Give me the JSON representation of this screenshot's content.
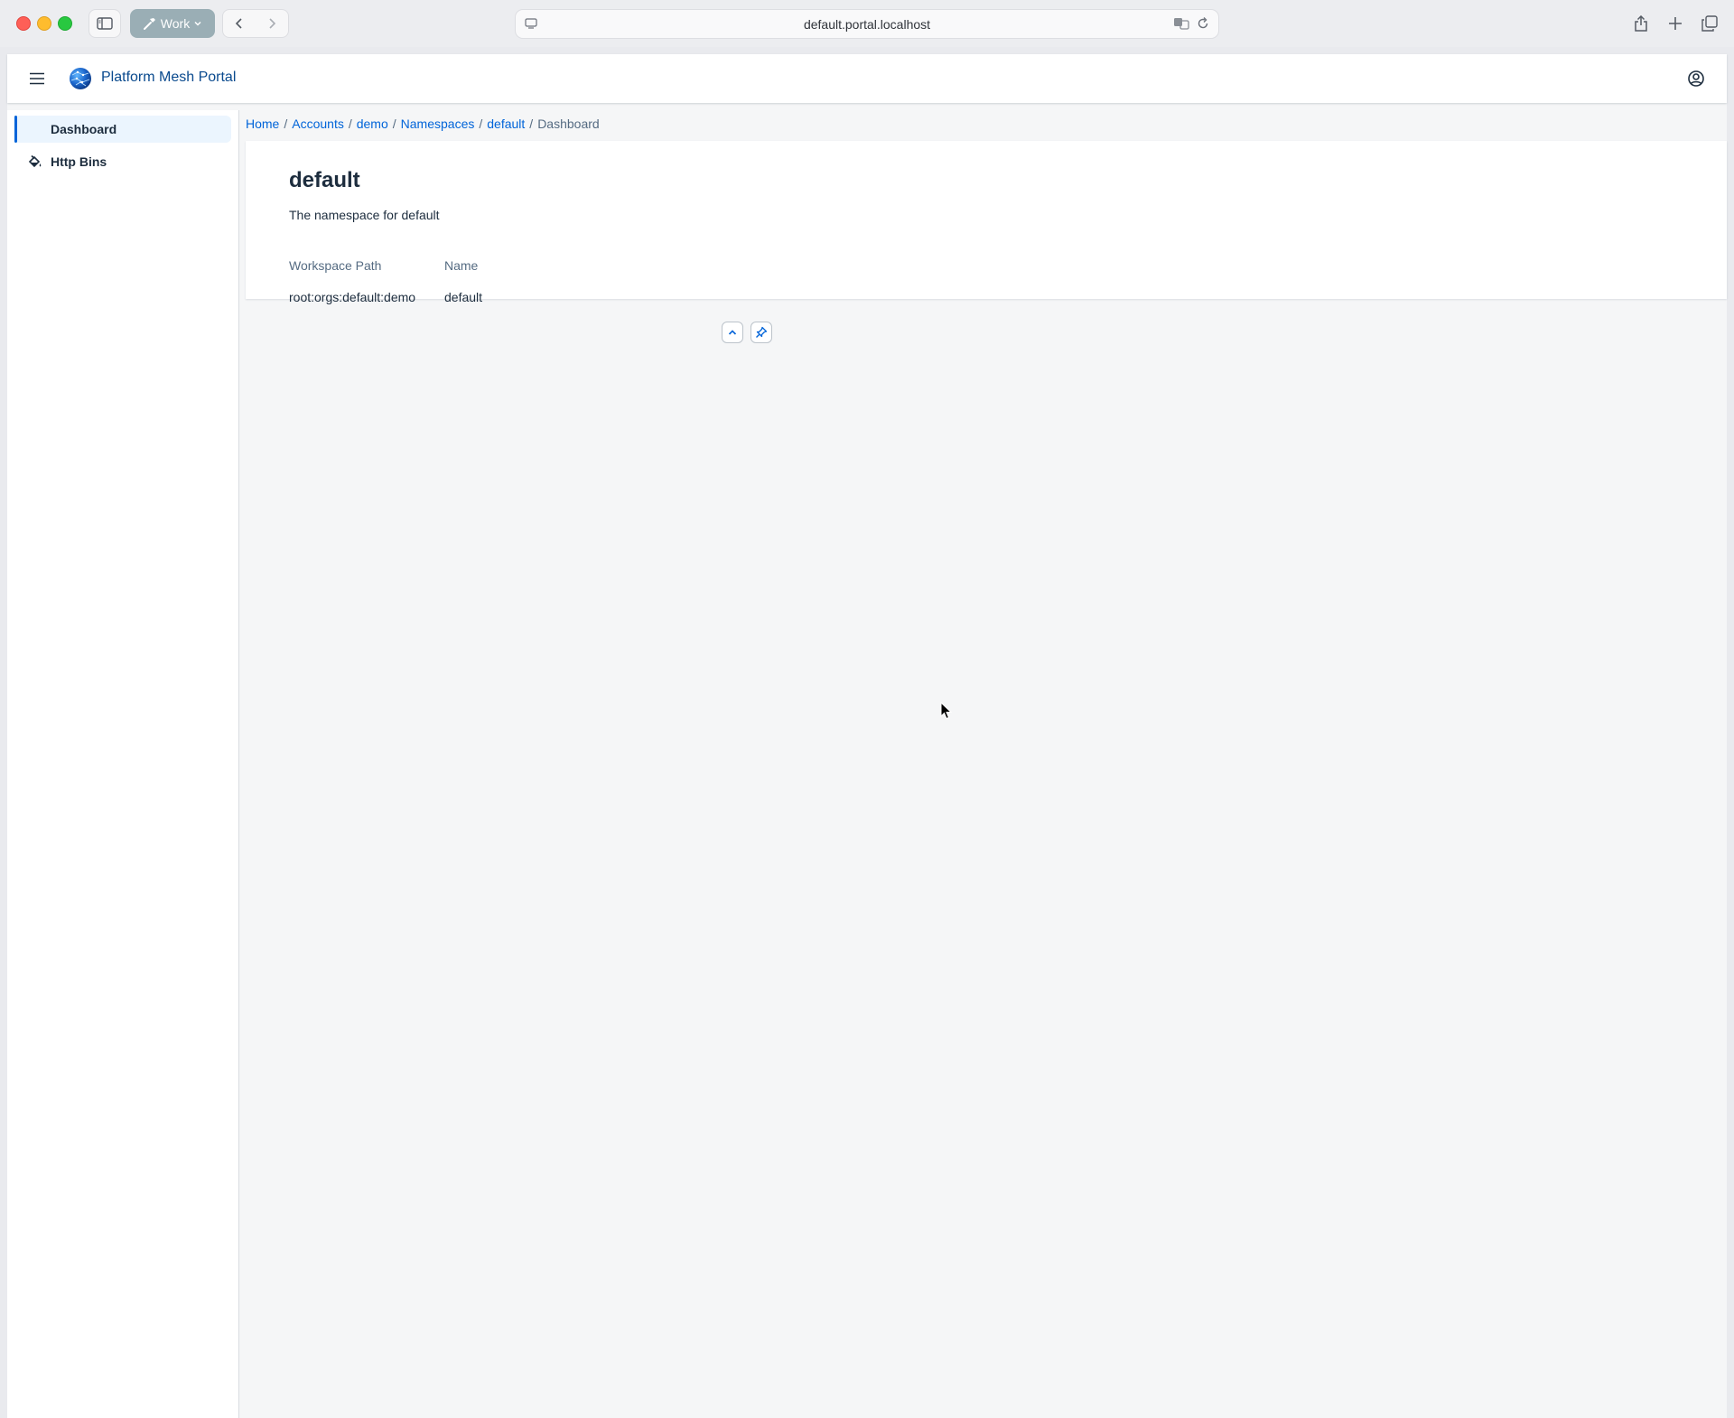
{
  "browser": {
    "profile_label": "Work",
    "url": "default.portal.localhost"
  },
  "shellbar": {
    "title": "Platform Mesh Portal"
  },
  "sidebar": {
    "items": [
      {
        "label": "Dashboard",
        "active": true
      },
      {
        "label": "Http Bins",
        "icon": "paint-bucket-icon"
      }
    ]
  },
  "breadcrumb": {
    "items": [
      {
        "label": "Home",
        "link": true
      },
      {
        "label": "Accounts",
        "link": true
      },
      {
        "label": "demo",
        "link": true
      },
      {
        "label": "Namespaces",
        "link": true
      },
      {
        "label": "default",
        "link": true
      },
      {
        "label": "Dashboard",
        "link": false
      }
    ],
    "separator": "/"
  },
  "header": {
    "title": "default",
    "subtitle": "The namespace for default",
    "attributes": [
      {
        "label": "Workspace Path",
        "value": "root:orgs:default:demo"
      },
      {
        "label": "Name",
        "value": "default"
      }
    ]
  },
  "colors": {
    "accent": "#0064d9",
    "title_blue": "#0a4a8e",
    "nav_active_bg": "#ebf5fe",
    "text": "#1d2d3e",
    "muted": "#556b82"
  }
}
